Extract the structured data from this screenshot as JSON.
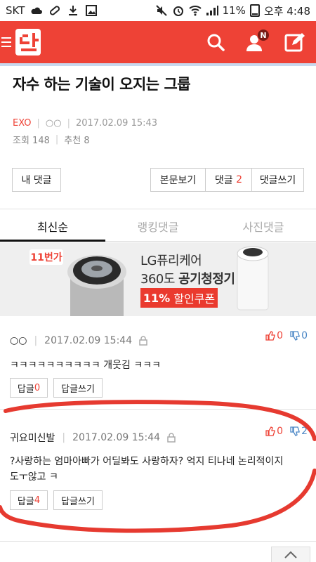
{
  "status_bar": {
    "carrier": "SKT",
    "battery": "11%",
    "time": "오후 4:48"
  },
  "colors": {
    "brand": "#ee4236",
    "vote_up": "#ee4236",
    "vote_down": "#4a86c5",
    "annotation": "#e63a30"
  },
  "app_bar": {
    "logo_text": "판",
    "notification_badge": "N"
  },
  "article": {
    "title": "자수 하는 기술이 오지는 그룹",
    "category": "EXO",
    "author": "○○",
    "date": "2017.02.09 15:43",
    "views": "조회 148",
    "recommends": "추천 8"
  },
  "buttons": {
    "my_comments": "내 댓글",
    "view_original": "본문보기",
    "comments_label": "댓글",
    "comments_count": "2",
    "write_comment": "댓글쓰기"
  },
  "tabs": [
    {
      "label": "최신순"
    },
    {
      "label": "랭킹댓글"
    },
    {
      "label": "사진댓글"
    }
  ],
  "ad": {
    "store_logo": "11번가",
    "line1": "LG퓨리케어",
    "line2_plain": "360도",
    "line2_bold": "공기청정기",
    "discount_pct": "11%",
    "discount_text": "할인쿠폰"
  },
  "comments": [
    {
      "nick": "○○",
      "date": "2017.02.09 15:44",
      "up": "0",
      "down": "0",
      "body": "ㅋㅋㅋㅋㅋㅋㅋㅋㅋㅋ 개웃김 ㅋㅋㅋ",
      "reply_label": "답글",
      "reply_count": "0",
      "write_reply": "답글쓰기"
    },
    {
      "nick": "귀요미신발",
      "date": "2017.02.09 15:44",
      "up": "0",
      "down": "2",
      "body_line1": "?사랑하는 엄마아빠가 어딜봐도 사랑하자? 억지 티나네 논리적이지",
      "body_line2": "도ㅜ않고 ㅋ",
      "reply_label": "답글",
      "reply_count": "4",
      "write_reply": "답글쓰기"
    }
  ]
}
